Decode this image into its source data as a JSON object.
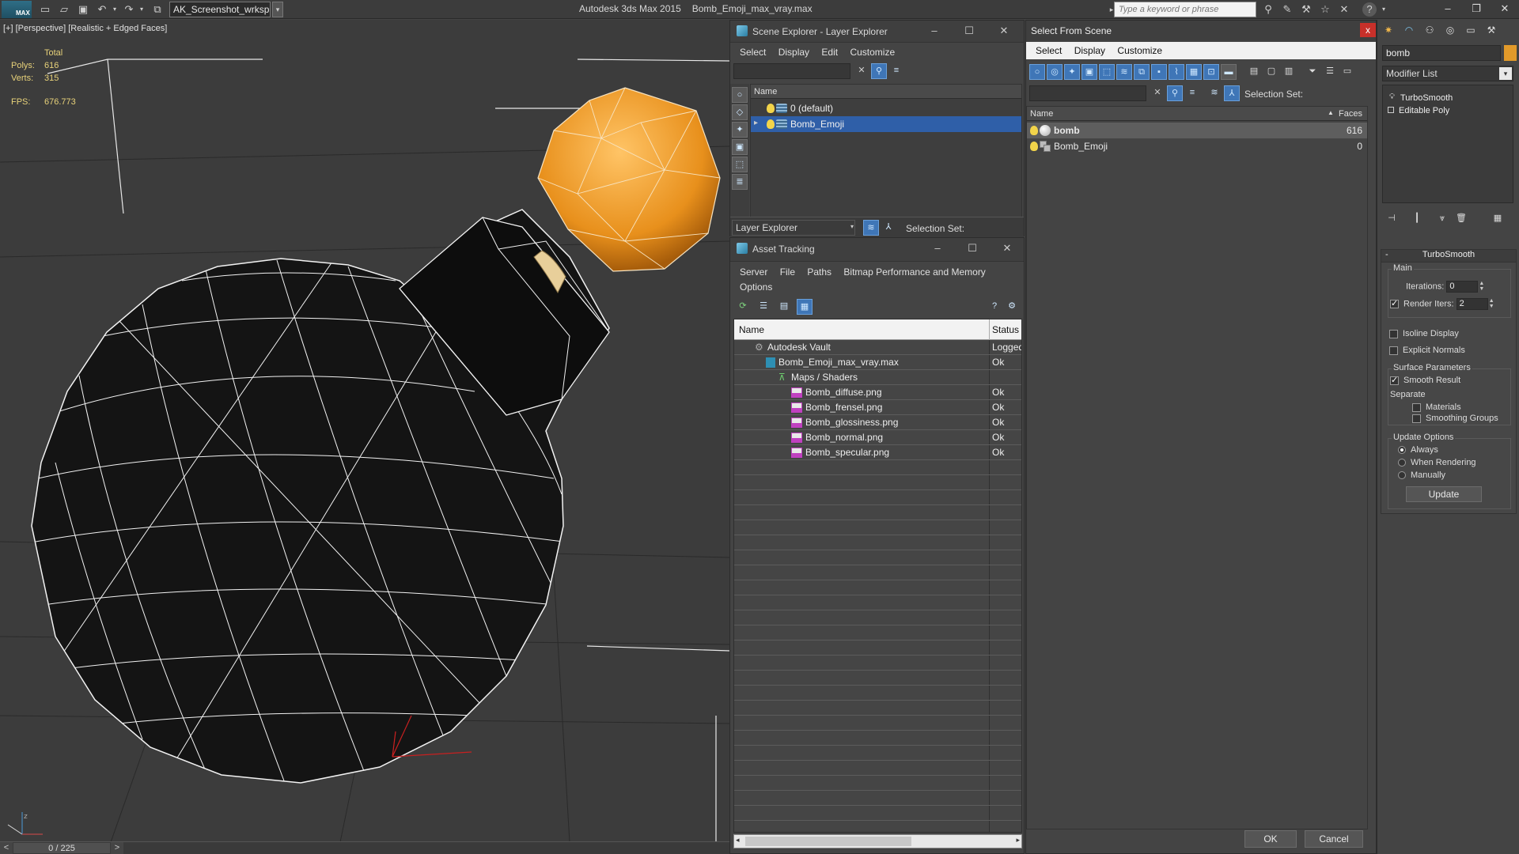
{
  "titlebar": {
    "logo": "MAX",
    "workspace": "AK_Screenshot_wrksp",
    "app_name": "Autodesk 3ds Max  2015",
    "file_name": "Bomb_Emoji_max_vray.max",
    "search_placeholder": "Type a keyword or phrase"
  },
  "viewport": {
    "label": "[+] [Perspective] [Realistic + Edged Faces]",
    "stats": {
      "header": "Total",
      "polys_label": "Polys:",
      "polys_value": "616",
      "verts_label": "Verts:",
      "verts_value": "315",
      "fps_label": "FPS:",
      "fps_value": "676.773"
    },
    "colors": {
      "bomb_body": "#141414",
      "fuse_cap": "#e8901c",
      "wire": "#ffffff"
    }
  },
  "timeslider": {
    "prev": "<",
    "frame": "0 / 225",
    "next": ">"
  },
  "scene_explorer": {
    "title": "Scene Explorer - Layer Explorer",
    "menu": [
      "Select",
      "Display",
      "Edit",
      "Customize"
    ],
    "column_name": "Name",
    "layers": [
      {
        "name": "0 (default)",
        "selected": false
      },
      {
        "name": "Bomb_Emoji",
        "selected": true
      }
    ],
    "explorer_dropdown": "Layer Explorer",
    "selection_set_label": "Selection Set:"
  },
  "asset_tracking": {
    "title": "Asset Tracking",
    "menu_row1": [
      "Server",
      "File",
      "Paths",
      "Bitmap Performance and Memory"
    ],
    "menu_row2": [
      "Options"
    ],
    "col_name": "Name",
    "col_status": "Status",
    "rows": [
      {
        "name": "Autodesk Vault",
        "status": "Logged Out",
        "indent": 0,
        "icon": "vault-icon"
      },
      {
        "name": "Bomb_Emoji_max_vray.max",
        "status": "Ok",
        "indent": 1,
        "icon": "max-file-icon"
      },
      {
        "name": "Maps / Shaders",
        "status": "",
        "indent": 2,
        "icon": "maps-icon"
      },
      {
        "name": "Bomb_diffuse.png",
        "status": "Ok",
        "indent": 3,
        "icon": "png-icon"
      },
      {
        "name": "Bomb_frensel.png",
        "status": "Ok",
        "indent": 3,
        "icon": "png-icon"
      },
      {
        "name": "Bomb_glossiness.png",
        "status": "Ok",
        "indent": 3,
        "icon": "png-icon"
      },
      {
        "name": "Bomb_normal.png",
        "status": "Ok",
        "indent": 3,
        "icon": "png-icon"
      },
      {
        "name": "Bomb_specular.png",
        "status": "Ok",
        "indent": 3,
        "icon": "png-icon"
      }
    ]
  },
  "select_from_scene": {
    "title": "Select From Scene",
    "close": "x",
    "menu": [
      "Select",
      "Display",
      "Customize"
    ],
    "selection_set_label": "Selection Set:",
    "col_name": "Name",
    "col_faces": "Faces",
    "rows": [
      {
        "name": "bomb",
        "faces": "616",
        "selected": true
      },
      {
        "name": "Bomb_Emoji",
        "faces": "0",
        "selected": false
      }
    ],
    "ok_label": "OK",
    "cancel_label": "Cancel"
  },
  "command_panel": {
    "object_name": "bomb",
    "object_color": "#e29a2a",
    "modifier_list": "Modifier List",
    "stack": [
      "TurboSmooth",
      "Editable Poly"
    ],
    "turbosmooth": {
      "title": "TurboSmooth",
      "main_label": "Main",
      "iterations_label": "Iterations:",
      "iterations_value": "0",
      "render_iters_label": "Render Iters:",
      "render_iters_value": "2",
      "isoline_label": "Isoline Display",
      "explicit_normals_label": "Explicit Normals",
      "surface_label": "Surface Parameters",
      "smooth_result_label": "Smooth Result",
      "separate_label": "Separate",
      "materials_label": "Materials",
      "smoothing_groups_label": "Smoothing Groups",
      "update_options_label": "Update Options",
      "always_label": "Always",
      "when_rendering_label": "When Rendering",
      "manually_label": "Manually",
      "update_button": "Update"
    }
  }
}
